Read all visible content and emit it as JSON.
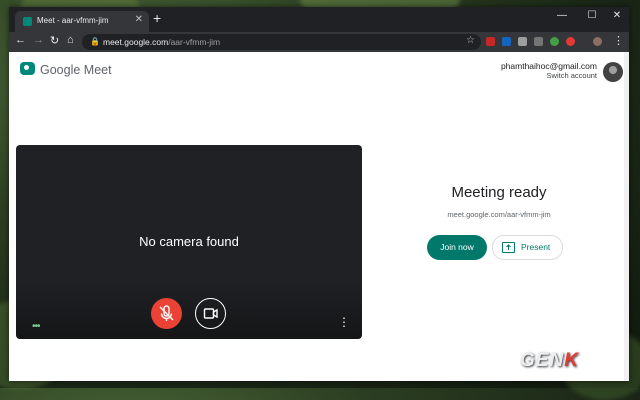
{
  "browser": {
    "tab_title": "Meet - aar-vfmm-jim",
    "tab_close": "✕",
    "new_tab": "+",
    "window_controls": {
      "minimize": "—",
      "maximize": "☐",
      "close": "✕"
    },
    "nav": {
      "back": "←",
      "forward": "→",
      "reload": "↻",
      "home": "⌂"
    },
    "url_host": "meet.google.com",
    "url_path": "/aar-vfmm-jim",
    "star": "☆",
    "menu": "⋮"
  },
  "app": {
    "name": "Google Meet",
    "account_email": "phamthaihoc@gmail.com",
    "switch_account": "Switch account"
  },
  "preview": {
    "message": "No camera found",
    "mic_state": "muted",
    "more_options": "⋮",
    "activity_dots": "•••"
  },
  "join_panel": {
    "title": "Meeting ready",
    "meeting_url": "meet.google.com/aar-vfmm-jim",
    "join_label": "Join now",
    "present_label": "Present"
  },
  "watermark": {
    "text1": "GEN",
    "text2": "K"
  },
  "colors": {
    "accent": "#00796b",
    "mic_off": "#ea4335",
    "chrome_dark": "#202124"
  }
}
